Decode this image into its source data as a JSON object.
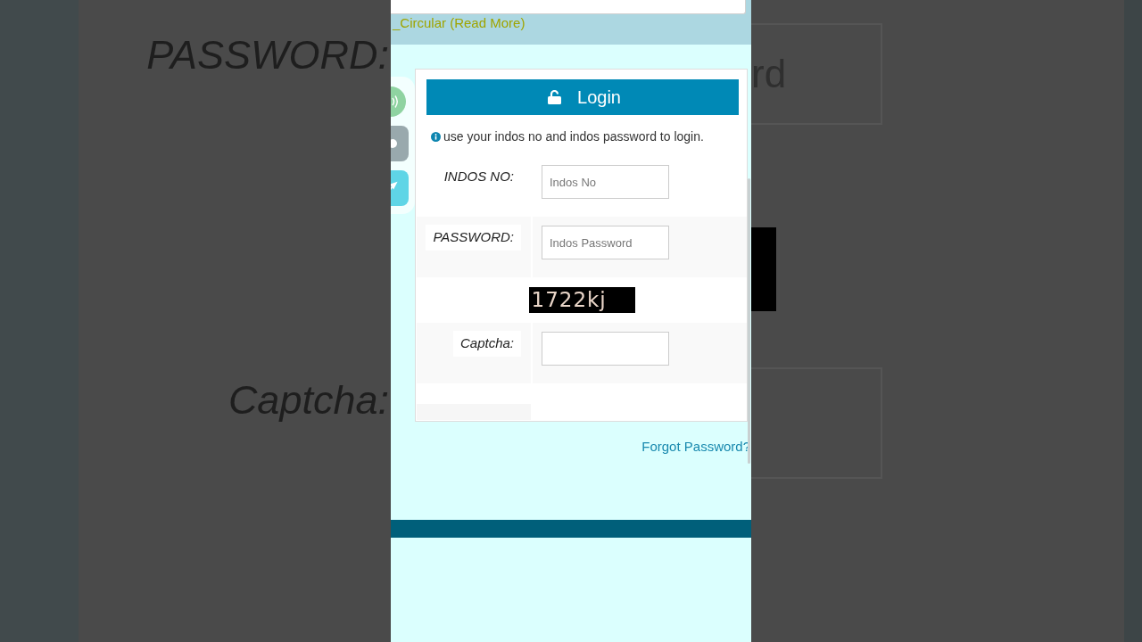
{
  "backdrop": {
    "left_labels": [
      "PASSWORD:",
      "Captcha:"
    ],
    "right_field": {
      "placeholder": "rd"
    }
  },
  "page": {
    "banner_text": "_Circular (Read More)",
    "side_widgets": [
      {
        "kind": "wave"
      },
      {
        "kind": "dot"
      },
      {
        "kind": "pin"
      }
    ],
    "login": {
      "title": "Login",
      "hint": "use your indos no and indos password to login.",
      "rows": [
        {
          "kind": "field",
          "label": "INDOS NO:",
          "placeholder": "Indos No"
        },
        {
          "kind": "field",
          "label": "PASSWORD:",
          "placeholder": "Indos Password"
        },
        {
          "kind": "captcha",
          "text": "1722kj"
        },
        {
          "kind": "field",
          "label": "Captcha:"
        }
      ]
    },
    "forgot_password_link": "Forgot Password?"
  }
}
